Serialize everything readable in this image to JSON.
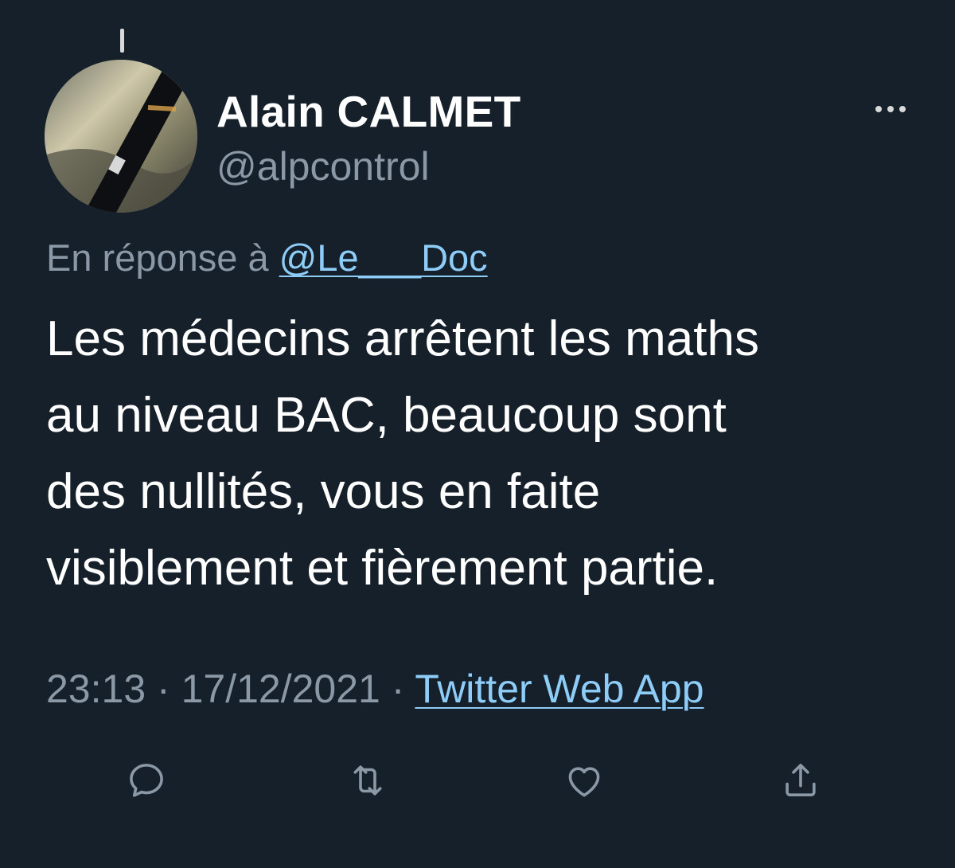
{
  "tweet": {
    "author": {
      "display_name": "Alain CALMET",
      "handle": "@alpcontrol"
    },
    "reply_prefix": "En réponse à",
    "reply_to": "@Le___Doc",
    "text_lines": [
      "Les médecins arrêtent les maths",
      "au niveau BAC, beaucoup sont",
      "des nullités, vous en faite",
      "visiblement et fièrement partie."
    ],
    "time": "23:13",
    "separator": "·",
    "date": "17/12/2021",
    "source": "Twitter Web App"
  },
  "icons": {
    "more": "more-horizontal-icon",
    "reply": "reply-bubble-icon",
    "retweet": "retweet-icon",
    "like": "heart-icon",
    "share": "share-upload-icon"
  },
  "colors": {
    "background": "#15202b",
    "primary_text": "#ffffff",
    "secondary_text": "#8b98a5",
    "link": "#8ecdf8"
  }
}
